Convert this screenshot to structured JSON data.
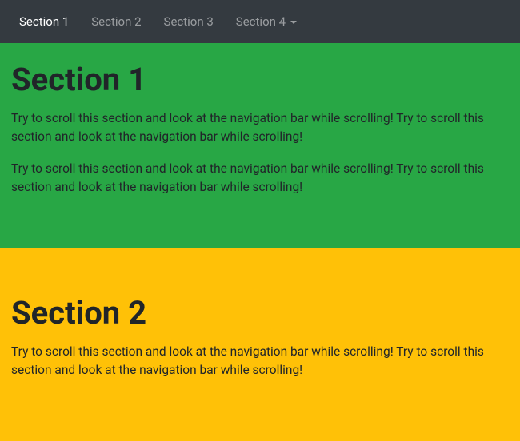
{
  "nav": {
    "items": [
      {
        "label": "Section 1",
        "active": true,
        "dropdown": false
      },
      {
        "label": "Section 2",
        "active": false,
        "dropdown": false
      },
      {
        "label": "Section 3",
        "active": false,
        "dropdown": false
      },
      {
        "label": "Section 4",
        "active": false,
        "dropdown": true
      }
    ]
  },
  "sections": [
    {
      "heading": "Section 1",
      "paragraphs": [
        "Try to scroll this section and look at the navigation bar while scrolling! Try to scroll this section and look at the navigation bar while scrolling!",
        "Try to scroll this section and look at the navigation bar while scrolling! Try to scroll this section and look at the navigation bar while scrolling!"
      ]
    },
    {
      "heading": "Section 2",
      "paragraphs": [
        "Try to scroll this section and look at the navigation bar while scrolling! Try to scroll this section and look at the navigation bar while scrolling!"
      ]
    }
  ],
  "colors": {
    "navbar_bg": "#343a40",
    "section1_bg": "#28a745",
    "section2_bg": "#ffc107"
  }
}
